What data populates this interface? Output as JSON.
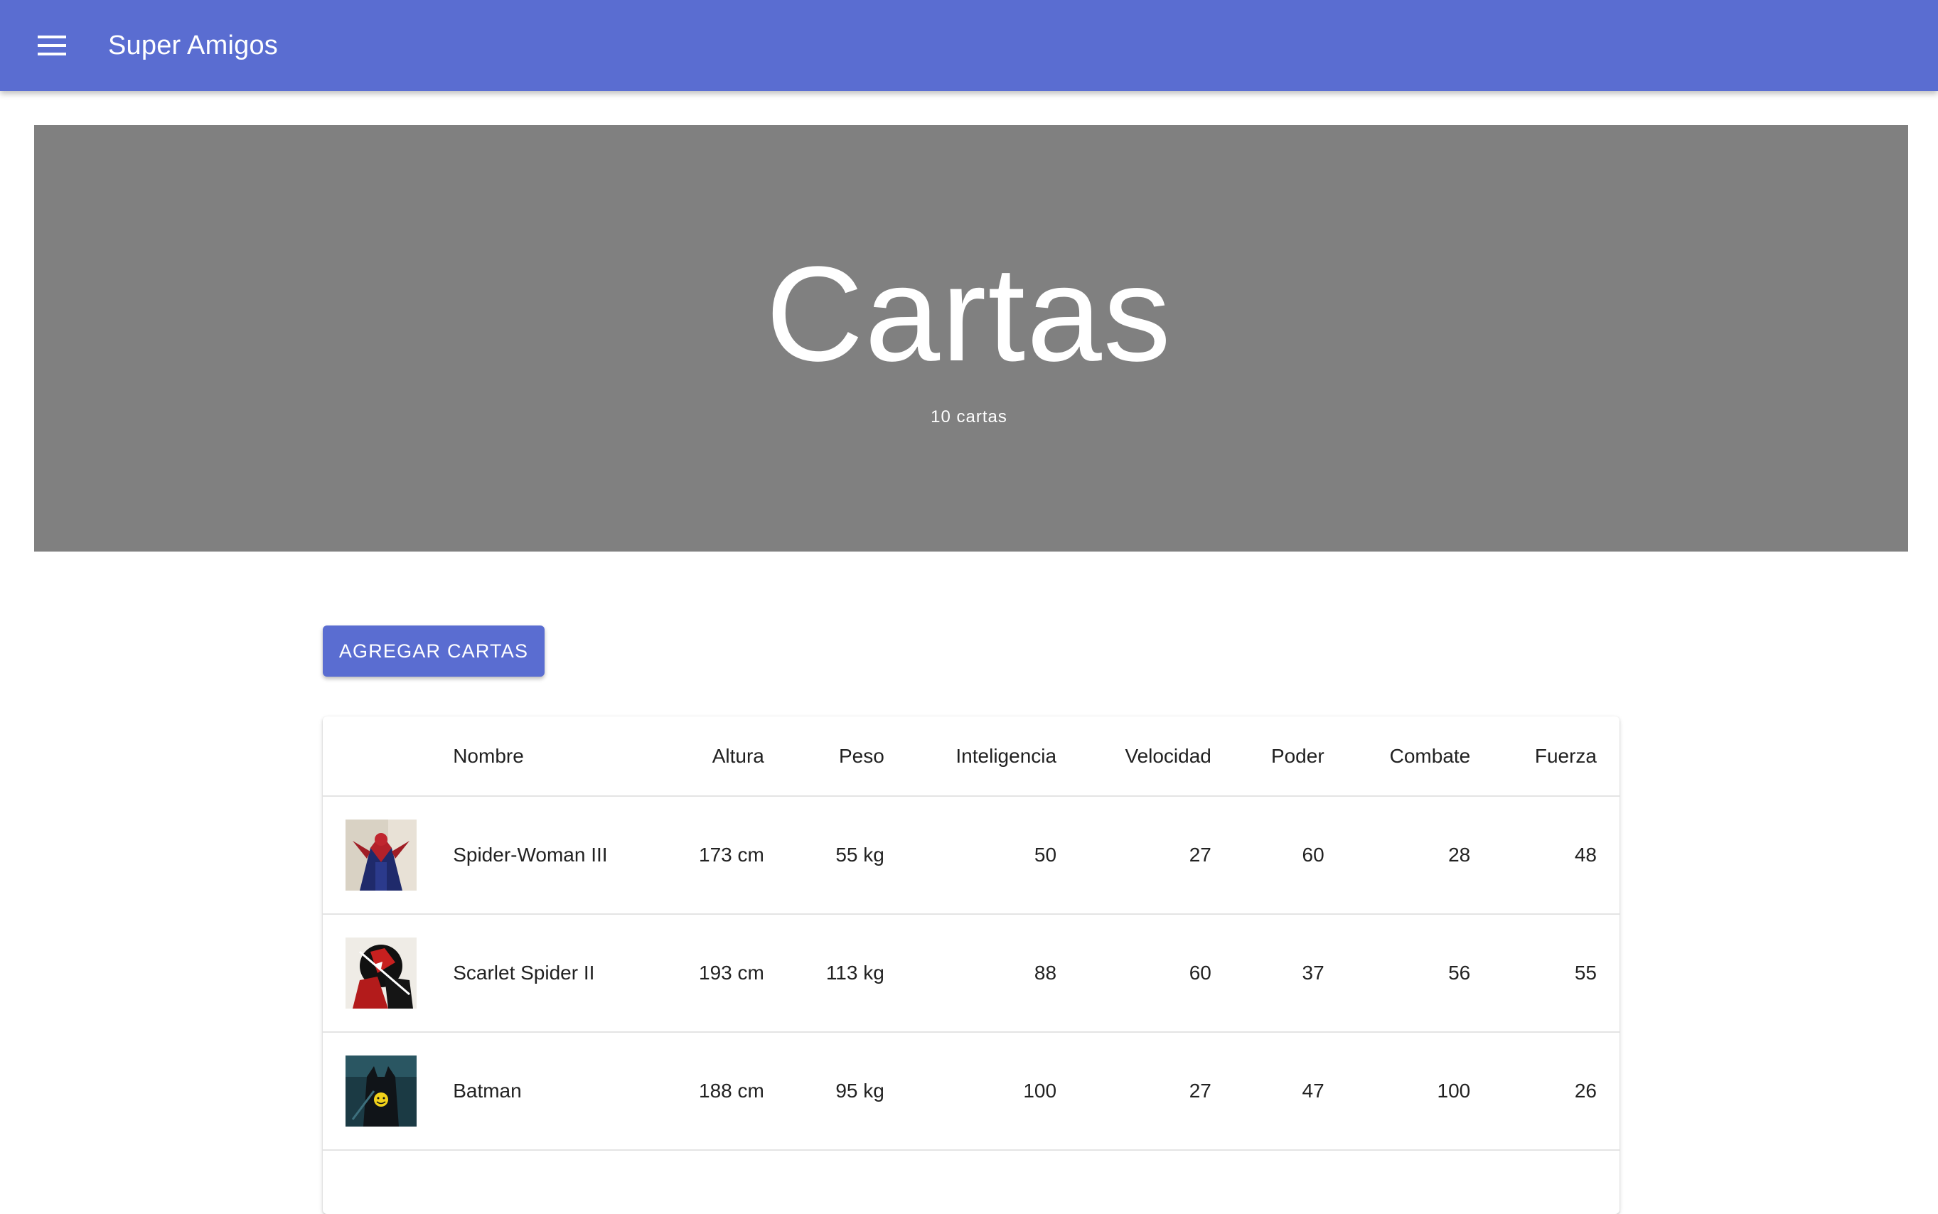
{
  "appbar": {
    "title": "Super Amigos",
    "menu_icon": "menu-icon",
    "color": "#5a6dd1"
  },
  "hero": {
    "title": "Cartas",
    "subtitle": "10 cartas",
    "background": "#808080"
  },
  "actions": {
    "add_label": "AGREGAR CARTAS"
  },
  "table": {
    "columns": [
      "",
      "Nombre",
      "Altura",
      "Peso",
      "Inteligencia",
      "Velocidad",
      "Poder",
      "Combate",
      "Fuerza"
    ],
    "rows": [
      {
        "image": "spider-woman-iii-thumbnail",
        "nombre": "Spider-Woman III",
        "altura": "173 cm",
        "peso": "55 kg",
        "inteligencia": "50",
        "velocidad": "27",
        "poder": "60",
        "combate": "28",
        "fuerza": "48"
      },
      {
        "image": "scarlet-spider-ii-thumbnail",
        "nombre": "Scarlet Spider II",
        "altura": "193 cm",
        "peso": "113 kg",
        "inteligencia": "88",
        "velocidad": "60",
        "poder": "37",
        "combate": "56",
        "fuerza": "55"
      },
      {
        "image": "batman-thumbnail",
        "nombre": "Batman",
        "altura": "188 cm",
        "peso": "95 kg",
        "inteligencia": "100",
        "velocidad": "27",
        "poder": "47",
        "combate": "100",
        "fuerza": "26"
      }
    ]
  }
}
